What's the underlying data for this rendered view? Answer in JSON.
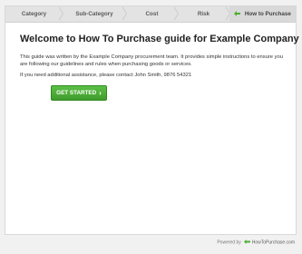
{
  "steps": [
    {
      "label": "Category"
    },
    {
      "label": "Sub-Category"
    },
    {
      "label": "Cost"
    },
    {
      "label": "Risk"
    },
    {
      "label": "How to Purchase",
      "icon": "back-arrow-icon"
    }
  ],
  "main": {
    "title": "Welcome to How To Purchase guide for Example Company",
    "intro": "This guide was written by the Example Company procurement team. It provides simple instructions to ensure you are following our guidelines and rules when purchasing goods or services.",
    "assistance": "If you need additional assistance, please contact John Smith, 9876 54321",
    "cta_label": "GET STARTED"
  },
  "footer": {
    "powered_by": "Powered by",
    "brand": "HowToPurchase.com"
  },
  "colors": {
    "accent_green": "#4caf37",
    "step_bar": "#e3e3e3"
  }
}
